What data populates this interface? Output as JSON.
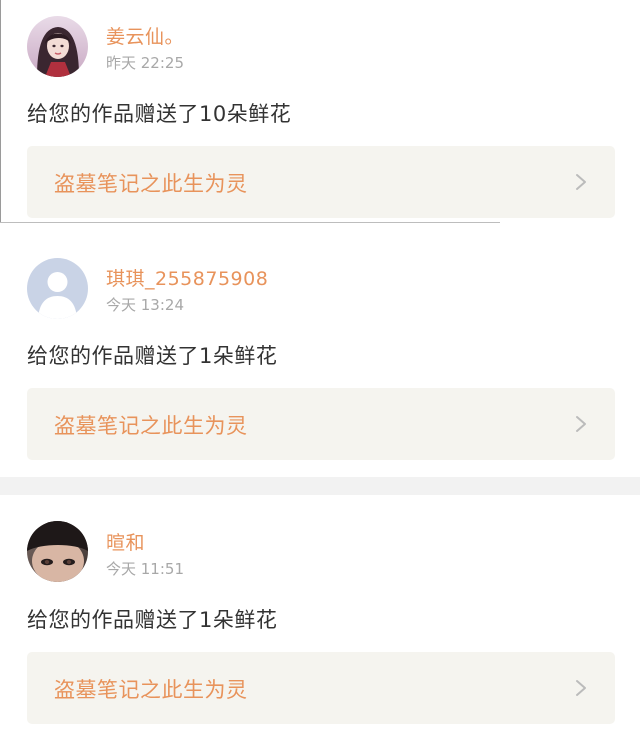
{
  "notifications": [
    {
      "avatar_icon": "user-photo-avatar-icon",
      "username": "姜云仙。",
      "timestamp": "昨天 22:25",
      "message": "给您的作品赠送了10朵鲜花",
      "work_title": "盗墓笔记之此生为灵"
    },
    {
      "avatar_icon": "default-user-avatar-icon",
      "username": "琪琪_255875908",
      "timestamp": "今天 13:24",
      "message": "给您的作品赠送了1朵鲜花",
      "work_title": "盗墓笔记之此生为灵"
    },
    {
      "avatar_icon": "user-photo-avatar-icon",
      "username": "暄和",
      "timestamp": "今天 11:51",
      "message": "给您的作品赠送了1朵鲜花",
      "work_title": "盗墓笔记之此生为灵"
    }
  ],
  "colors": {
    "accent": "#e8935b",
    "timestamp": "#a8a8a8",
    "message_text": "#333333",
    "link_background": "#f5f4ef",
    "chevron": "#bbbbbb",
    "separator": "#f2f2f2"
  },
  "icons": {
    "chevron": "chevron-right-icon"
  }
}
